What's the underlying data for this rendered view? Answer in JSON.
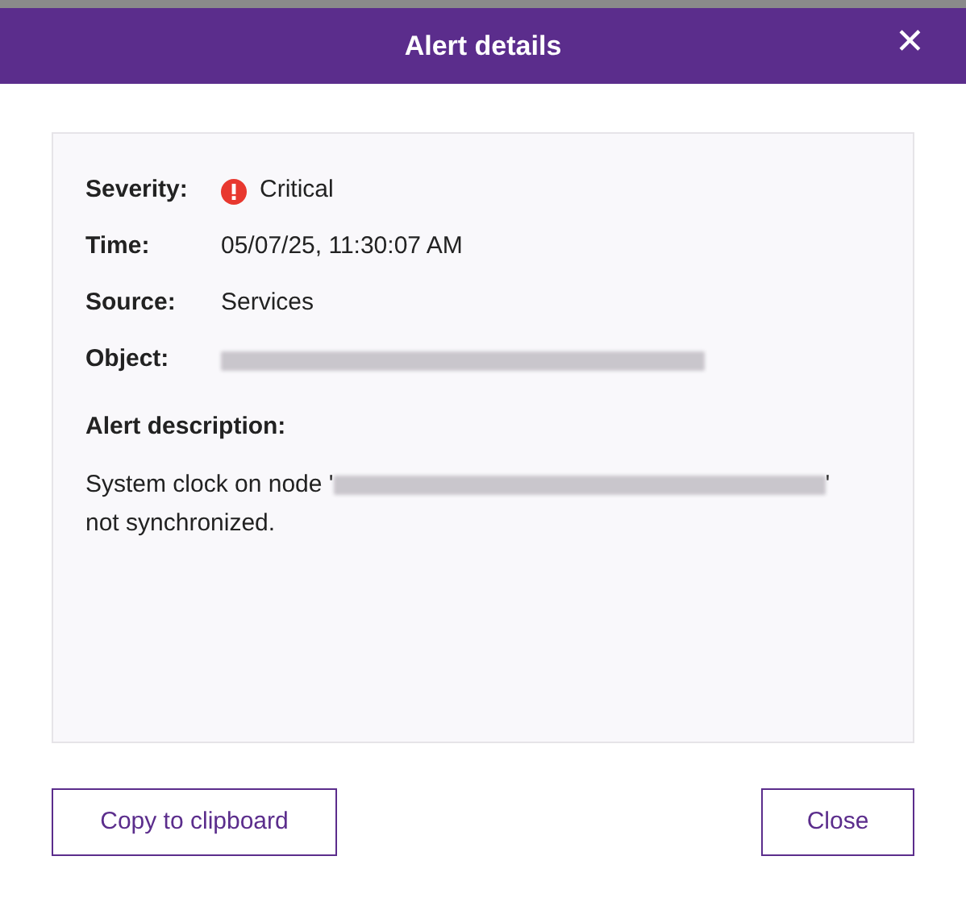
{
  "dialog": {
    "title": "Alert details",
    "close_icon": "✕"
  },
  "fields": [
    {
      "label": "Severity:",
      "kind": "severity",
      "value": "Critical",
      "color": "#e8382f"
    },
    {
      "label": "Time:",
      "kind": "text",
      "value": "05/07/25, 11:30:07 AM"
    },
    {
      "label": "Source:",
      "kind": "text",
      "value": "Services"
    },
    {
      "label": "Object:",
      "kind": "redacted"
    }
  ],
  "description": {
    "heading": "Alert description:",
    "before": "System clock on node '",
    "redacted": true,
    "after": "'",
    "second_line": "not synchronized."
  },
  "buttons": [
    {
      "label": "Copy to clipboard"
    },
    {
      "label": "Close"
    }
  ]
}
